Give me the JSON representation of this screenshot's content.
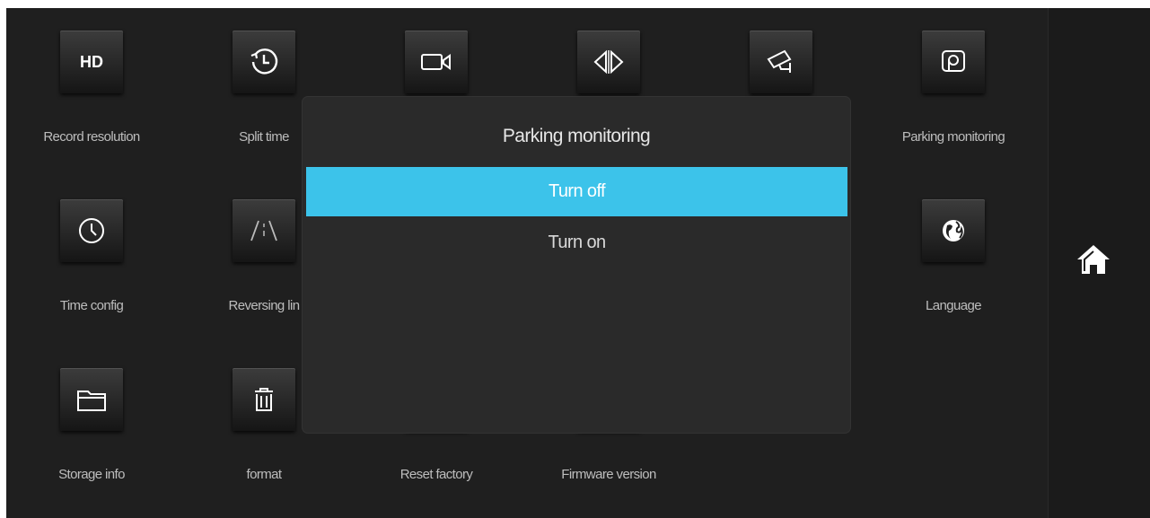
{
  "menu": {
    "items": [
      {
        "label": "Record resolution",
        "icon": "hd-icon",
        "icon_text": "HD"
      },
      {
        "label": "Split time",
        "icon": "clock-icon"
      },
      {
        "label": "",
        "icon": "video-camera-icon"
      },
      {
        "label": "",
        "icon": "mirror-arrows-icon"
      },
      {
        "label": "",
        "icon": "cctv-camera-icon"
      },
      {
        "label": "Parking monitoring",
        "icon": "parking-icon"
      },
      {
        "label": "Time config",
        "icon": "time-icon"
      },
      {
        "label": "Reversing lin",
        "icon": "reversing-lines-icon"
      },
      {
        "label": "Language",
        "icon": "globe-icon"
      },
      {
        "label": "Storage info",
        "icon": "folder-icon"
      },
      {
        "label": "format",
        "icon": "trash-icon"
      },
      {
        "label": "Reset factory",
        "icon": "reset-icon"
      },
      {
        "label": "Firmware version",
        "icon": "firmware-icon"
      }
    ]
  },
  "dialog": {
    "title": "Parking monitoring",
    "options": [
      {
        "label": "Turn off",
        "selected": true
      },
      {
        "label": "Turn on",
        "selected": false
      }
    ]
  },
  "colors": {
    "background": "#1f1f1f",
    "dialog": "#2a2a2a",
    "accent": "#3cc3ea"
  },
  "rail": {
    "home_icon": "home-icon"
  }
}
